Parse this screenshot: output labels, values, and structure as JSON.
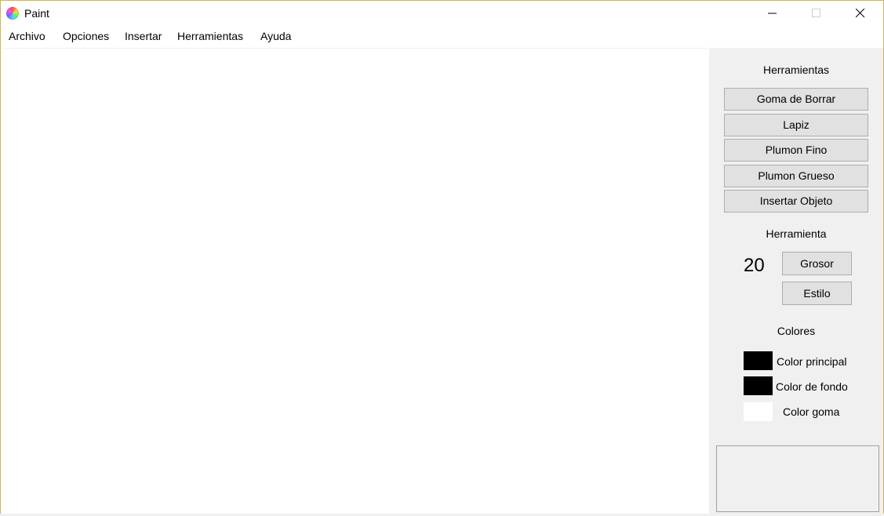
{
  "window": {
    "title": "Paint"
  },
  "menu": [
    "Archivo",
    "Opciones",
    "Insertar",
    "Herramientas",
    "Ayuda"
  ],
  "panel": {
    "tools_heading": "Herramientas",
    "tools": [
      "Goma de Borrar",
      "Lapiz",
      "Plumon Fino",
      "Plumon Grueso",
      "Insertar Objeto"
    ],
    "tool_heading": "Herramienta",
    "thickness_value": "20",
    "grosor_label": "Grosor",
    "estilo_label": "Estilo",
    "colors_heading": "Colores",
    "colors": [
      {
        "label": "Color principal",
        "color": "#000000"
      },
      {
        "label": "Color de fondo",
        "color": "#000000"
      },
      {
        "label": "Color goma",
        "color": "#ffffff"
      }
    ]
  }
}
